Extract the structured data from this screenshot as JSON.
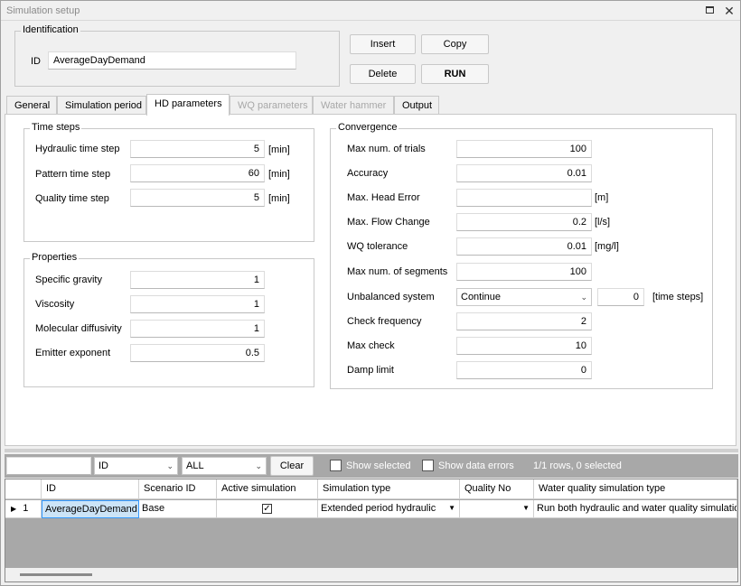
{
  "window": {
    "title": "Simulation setup",
    "restore_icon": "restore-icon",
    "close_icon": "close-icon",
    "close_glyph": "✕"
  },
  "identification": {
    "legend": "Identification",
    "id_label": "ID",
    "id_value": "AverageDayDemand"
  },
  "actions": {
    "insert": "Insert",
    "copy": "Copy",
    "delete": "Delete",
    "run": "RUN"
  },
  "tabs": [
    {
      "label": "General",
      "state": "normal"
    },
    {
      "label": "Simulation period",
      "state": "normal"
    },
    {
      "label": "HD parameters",
      "state": "active"
    },
    {
      "label": "WQ parameters",
      "state": "disabled"
    },
    {
      "label": "Water hammer",
      "state": "disabled"
    },
    {
      "label": "Output",
      "state": "normal"
    }
  ],
  "time_steps": {
    "legend": "Time steps",
    "rows": [
      {
        "label": "Hydraulic time step",
        "value": "5",
        "unit": "[min]"
      },
      {
        "label": "Pattern time step",
        "value": "60",
        "unit": "[min]"
      },
      {
        "label": "Quality time step",
        "value": "5",
        "unit": "[min]"
      }
    ]
  },
  "properties": {
    "legend": "Properties",
    "rows": [
      {
        "label": "Specific gravity",
        "value": "1"
      },
      {
        "label": "Viscosity",
        "value": "1"
      },
      {
        "label": "Molecular diffusivity",
        "value": "1"
      },
      {
        "label": "Emitter exponent",
        "value": "0.5"
      }
    ]
  },
  "convergence": {
    "legend": "Convergence",
    "max_trials": {
      "label": "Max num. of trials",
      "value": "100"
    },
    "accuracy": {
      "label": "Accuracy",
      "value": "0.01"
    },
    "head_error": {
      "label": "Max. Head Error",
      "value": "",
      "unit": "[m]"
    },
    "flow_change": {
      "label": "Max. Flow Change",
      "value": "0.2",
      "unit": "[l/s]"
    },
    "wq_tolerance": {
      "label": "WQ tolerance",
      "value": "0.01",
      "unit": "[mg/l]"
    },
    "max_segments": {
      "label": "Max num. of segments",
      "value": "100"
    },
    "unbalanced": {
      "label": "Unbalanced system",
      "option": "Continue",
      "steps": "0",
      "unit": "[time steps]"
    },
    "check_frequency": {
      "label": "Check frequency",
      "value": "2"
    },
    "max_check": {
      "label": "Max check",
      "value": "10"
    },
    "damp_limit": {
      "label": "Damp limit",
      "value": "0"
    }
  },
  "grid_toolbar": {
    "search_value": "",
    "column_filter": "ID",
    "value_filter": "ALL",
    "clear": "Clear",
    "show_selected": "Show selected",
    "show_errors": "Show data errors",
    "status": "1/1 rows, 0 selected"
  },
  "grid": {
    "columns": [
      "ID",
      "Scenario ID",
      "Active simulation",
      "Simulation type",
      "Quality No",
      "Water quality simulation type"
    ],
    "rows": [
      {
        "index": "1",
        "id": "AverageDayDemand",
        "scenario": "Base",
        "active": true,
        "sim_type": "Extended period hydraulic",
        "quality_no": "",
        "wq_type": "Run both hydraulic and water quality simulation"
      }
    ]
  }
}
